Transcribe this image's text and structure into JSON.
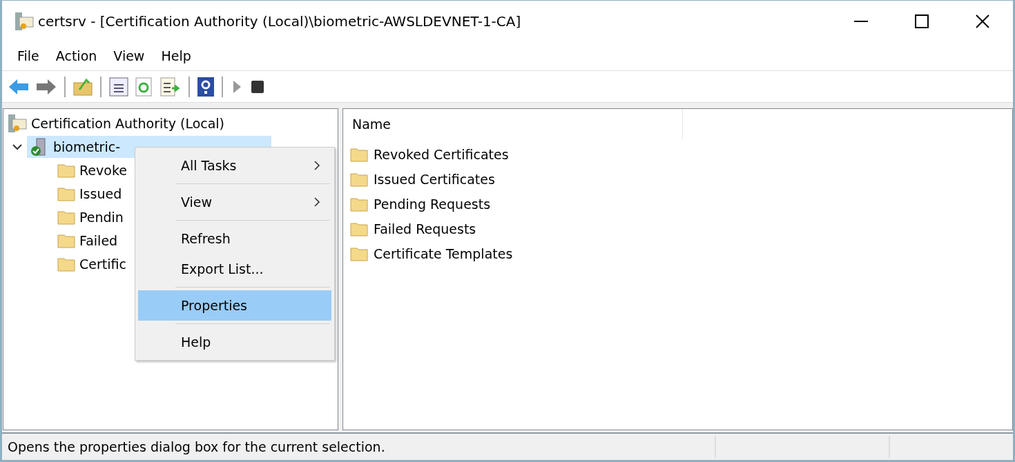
{
  "window": {
    "title": "certsrv - [Certification Authority (Local)\\biometric-AWSLDEVNET-1-CA]"
  },
  "menu_bar": [
    "File",
    "Action",
    "View",
    "Help"
  ],
  "tree": {
    "label": "Certification Authority (Local)",
    "children": [
      {
        "label": "biometric-",
        "selected": true,
        "expanded": true,
        "children": [
          {
            "label": "Revoke"
          },
          {
            "label": "Issued"
          },
          {
            "label": "Pendin"
          },
          {
            "label": "Failed"
          },
          {
            "label": "Certific"
          }
        ]
      }
    ]
  },
  "list": {
    "columns": [
      "Name"
    ],
    "rows": [
      "Revoked Certificates",
      "Issued Certificates",
      "Pending Requests",
      "Failed Requests",
      "Certificate Templates"
    ]
  },
  "context_menu": [
    {
      "label": "All Tasks",
      "submenu": true,
      "selected": false
    },
    {
      "label": "View",
      "submenu": true,
      "selected": false
    },
    {
      "label": "Refresh",
      "submenu": false,
      "selected": false
    },
    {
      "label": "Export List...",
      "submenu": false,
      "selected": false
    },
    {
      "label": "Properties",
      "submenu": false,
      "selected": true
    },
    {
      "label": "Help",
      "submenu": false,
      "selected": false
    }
  ],
  "status_bar": "Opens the properties dialog box for the current selection."
}
